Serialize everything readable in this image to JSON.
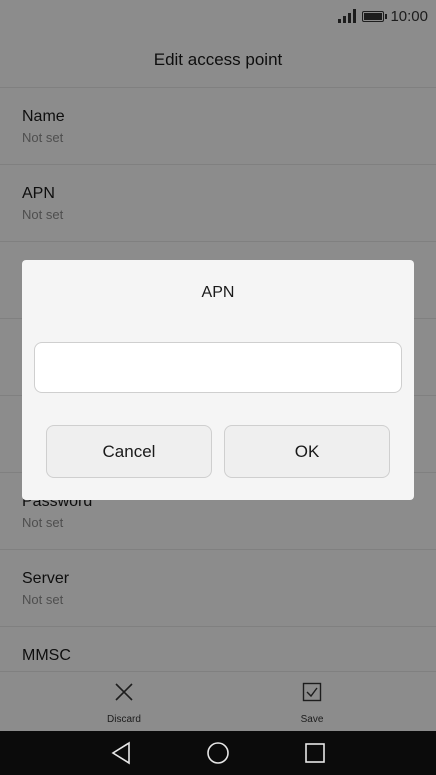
{
  "status_bar": {
    "time": "10:00"
  },
  "header": {
    "title": "Edit access point"
  },
  "fields": [
    {
      "label": "Name",
      "value": "Not set"
    },
    {
      "label": "APN",
      "value": "Not set"
    },
    {
      "label": "",
      "value": ""
    },
    {
      "label": "",
      "value": ""
    },
    {
      "label": "",
      "value": ""
    },
    {
      "label": "Password",
      "value": "Not set"
    },
    {
      "label": "Server",
      "value": "Not set"
    },
    {
      "label": "MMSC",
      "value": ""
    }
  ],
  "bottom_bar": {
    "discard_label": "Discard",
    "save_label": "Save"
  },
  "dialog": {
    "title": "APN",
    "input_value": "",
    "cancel_label": "Cancel",
    "ok_label": "OK"
  },
  "icons": {
    "signal": "signal-icon",
    "battery": "battery-icon",
    "discard": "close-icon",
    "save": "checkbox-check-icon",
    "back": "back-triangle-icon",
    "home": "home-circle-icon",
    "recents": "recents-square-icon"
  }
}
